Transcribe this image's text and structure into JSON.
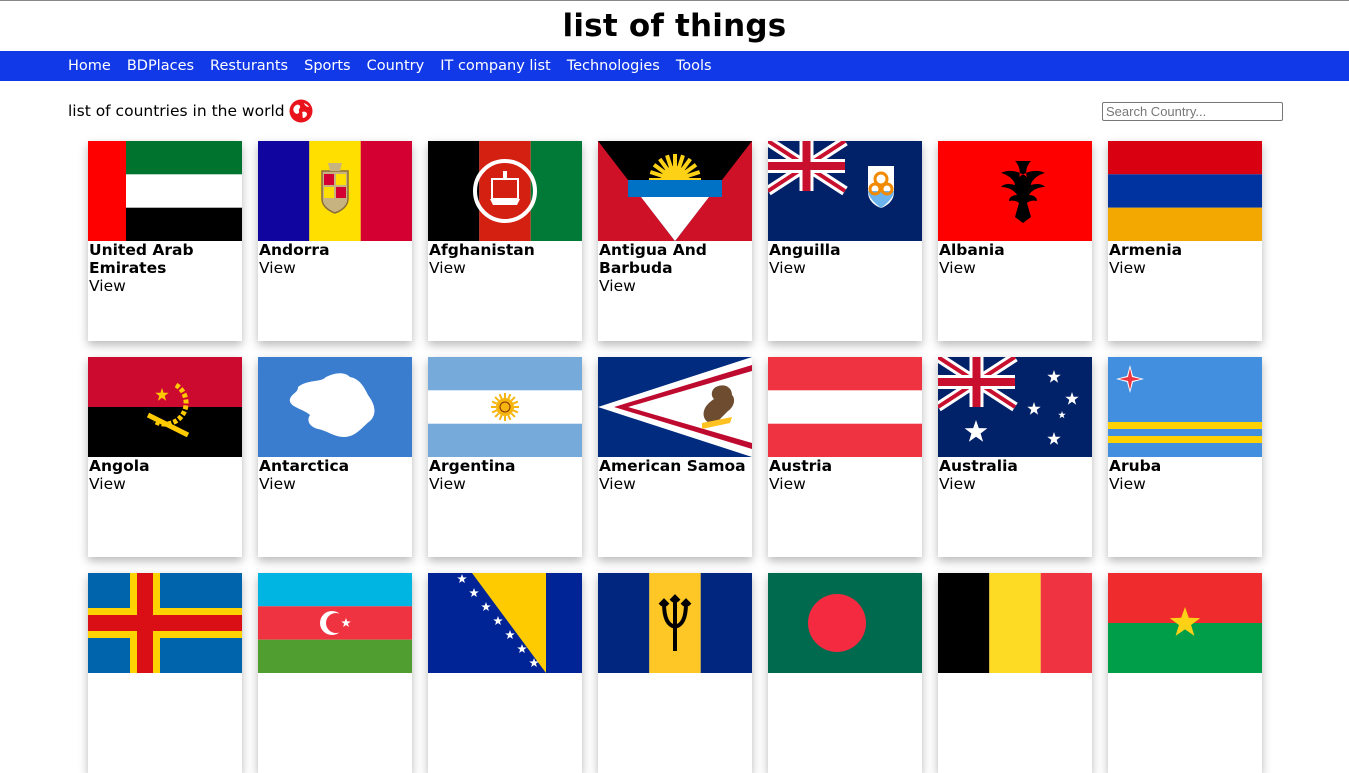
{
  "site": {
    "title": "list of things"
  },
  "nav": {
    "items": [
      {
        "label": "Home",
        "key": "home"
      },
      {
        "label": "BDPlaces",
        "key": "bdplaces"
      },
      {
        "label": "Resturants",
        "key": "resturants"
      },
      {
        "label": "Sports",
        "key": "sports"
      },
      {
        "label": "Country",
        "key": "country"
      },
      {
        "label": "IT company list",
        "key": "it-company-list"
      },
      {
        "label": "Technologies",
        "key": "technologies"
      },
      {
        "label": "Tools",
        "key": "tools"
      }
    ]
  },
  "page": {
    "heading": "list of countries in the world",
    "heading_icon": "globe-icon",
    "search_placeholder": "Search Country...",
    "search_value": ""
  },
  "colors": {
    "navbar": "#1239e8",
    "globe": "#e8131b"
  },
  "countries": [
    {
      "name": "United Arab Emirates",
      "view": "View",
      "flag": "uae"
    },
    {
      "name": "Andorra",
      "view": "View",
      "flag": "andorra"
    },
    {
      "name": "Afghanistan",
      "view": "View",
      "flag": "afghanistan"
    },
    {
      "name": "Antigua And Barbuda",
      "view": "View",
      "flag": "antigua"
    },
    {
      "name": "Anguilla",
      "view": "View",
      "flag": "anguilla"
    },
    {
      "name": "Albania",
      "view": "View",
      "flag": "albania"
    },
    {
      "name": "Armenia",
      "view": "View",
      "flag": "armenia"
    },
    {
      "name": "Angola",
      "view": "View",
      "flag": "angola"
    },
    {
      "name": "Antarctica",
      "view": "View",
      "flag": "antarctica"
    },
    {
      "name": "Argentina",
      "view": "View",
      "flag": "argentina"
    },
    {
      "name": "American Samoa",
      "view": "View",
      "flag": "american-samoa"
    },
    {
      "name": "Austria",
      "view": "View",
      "flag": "austria"
    },
    {
      "name": "Australia",
      "view": "View",
      "flag": "australia"
    },
    {
      "name": "Aruba",
      "view": "View",
      "flag": "aruba"
    },
    {
      "name": "",
      "view": "",
      "flag": "aland"
    },
    {
      "name": "",
      "view": "",
      "flag": "azerbaijan"
    },
    {
      "name": "",
      "view": "",
      "flag": "bosnia"
    },
    {
      "name": "",
      "view": "",
      "flag": "barbados"
    },
    {
      "name": "",
      "view": "",
      "flag": "bangladesh"
    },
    {
      "name": "",
      "view": "",
      "flag": "belgium"
    },
    {
      "name": "",
      "view": "",
      "flag": "burkina-faso"
    }
  ]
}
